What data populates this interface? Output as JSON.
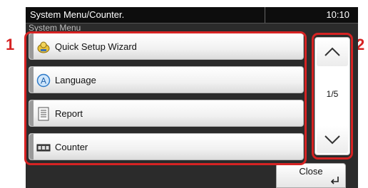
{
  "header": {
    "title": "System Menu/Counter.",
    "clock": "10:10",
    "subtitle": "System Menu"
  },
  "menu": {
    "items": [
      {
        "label": "Quick Setup Wizard",
        "icon": "wizard-icon"
      },
      {
        "label": "Language",
        "icon": "language-icon"
      },
      {
        "label": "Report",
        "icon": "report-icon"
      },
      {
        "label": "Counter",
        "icon": "counter-icon"
      }
    ]
  },
  "pager": {
    "indicator": "1/5",
    "up_icon": "chevron-up-icon",
    "down_icon": "chevron-down-icon"
  },
  "footer": {
    "close_label": "Close",
    "enter_icon": "enter-icon"
  },
  "callouts": {
    "one": "1",
    "two": "2"
  },
  "colors": {
    "callout": "#d62323",
    "panel_bg": "#2b2b2b",
    "titlebar_bg": "#0d0d0d"
  }
}
